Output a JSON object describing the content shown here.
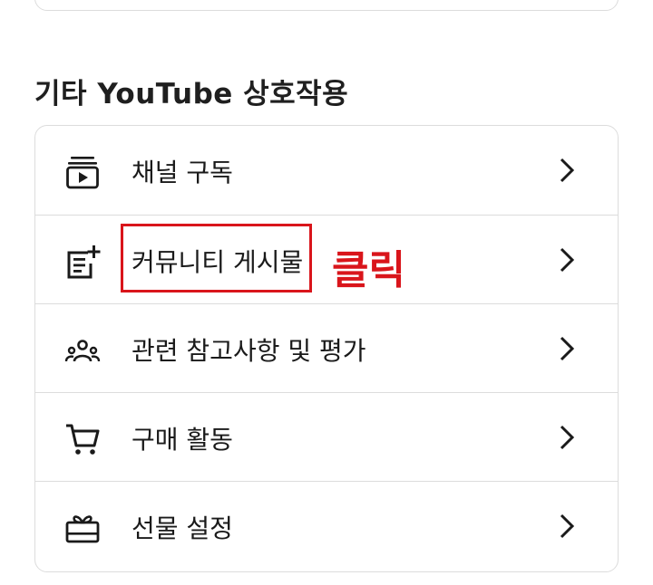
{
  "section": {
    "title": "기타 YouTube 상호작용"
  },
  "items": [
    {
      "label": "채널 구독",
      "icon": "subscriptions-icon"
    },
    {
      "label": "커뮤니티 게시물",
      "icon": "post-add-icon"
    },
    {
      "label": "관련 참고사항 및 평가",
      "icon": "people-group-icon"
    },
    {
      "label": "구매 활동",
      "icon": "shopping-cart-icon"
    },
    {
      "label": "선물 설정",
      "icon": "gift-icon"
    }
  ],
  "annotation": {
    "text": "클릭"
  },
  "colors": {
    "annotation": "#d9151b",
    "border": "#dcdcdc",
    "text": "#1a1a1a"
  }
}
